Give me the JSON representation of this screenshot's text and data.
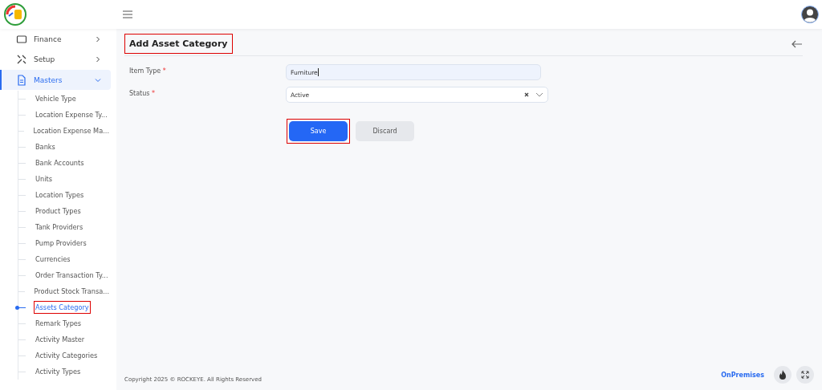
{
  "sidebar": {
    "groups": [
      {
        "label": "Finance",
        "expanded": false
      },
      {
        "label": "Setup",
        "expanded": false
      },
      {
        "label": "Masters",
        "expanded": true,
        "items": [
          {
            "label": "Vehicle Type",
            "selected": false,
            "highlighted": false
          },
          {
            "label": "Location Expense Ty...",
            "selected": false,
            "highlighted": false
          },
          {
            "label": "Location Expense Ma...",
            "selected": false,
            "highlighted": false
          },
          {
            "label": "Banks",
            "selected": false,
            "highlighted": false
          },
          {
            "label": "Bank Accounts",
            "selected": false,
            "highlighted": false
          },
          {
            "label": "Units",
            "selected": false,
            "highlighted": false
          },
          {
            "label": "Location Types",
            "selected": false,
            "highlighted": false
          },
          {
            "label": "Product Types",
            "selected": false,
            "highlighted": false
          },
          {
            "label": "Tank Providers",
            "selected": false,
            "highlighted": false
          },
          {
            "label": "Pump Providers",
            "selected": false,
            "highlighted": false
          },
          {
            "label": "Currencies",
            "selected": false,
            "highlighted": false
          },
          {
            "label": "Order Transaction Ty...",
            "selected": false,
            "highlighted": false
          },
          {
            "label": "Product Stock Transa...",
            "selected": false,
            "highlighted": false
          },
          {
            "label": "Assets Category",
            "selected": true,
            "highlighted": true
          },
          {
            "label": "Remark Types",
            "selected": false,
            "highlighted": false
          },
          {
            "label": "Activity Master",
            "selected": false,
            "highlighted": false
          },
          {
            "label": "Activity Categories",
            "selected": false,
            "highlighted": false
          },
          {
            "label": "Activity Types",
            "selected": false,
            "highlighted": false
          }
        ]
      }
    ]
  },
  "page": {
    "title": "Add Asset Category",
    "title_highlighted": true
  },
  "form": {
    "fields": [
      {
        "kind": "text",
        "label": "Item Type",
        "required_mark": "*",
        "value": "Furniture"
      },
      {
        "kind": "select",
        "label": "Status",
        "required_mark": "*",
        "value": "Active"
      }
    ]
  },
  "buttons": [
    {
      "kind": "primary",
      "label": "Save",
      "highlighted": true
    },
    {
      "kind": "secondary",
      "label": "Discard",
      "highlighted": false
    }
  ],
  "footer": {
    "copyright": "Copyright 2025 © ROCKEYE. All Rights Reserved",
    "mode": "OnPremises"
  }
}
